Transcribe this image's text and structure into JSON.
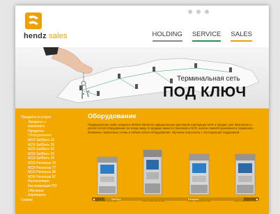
{
  "header": {
    "logo_brand": "hendz",
    "logo_sub": "sales",
    "nav": [
      {
        "label": "HOLDING"
      },
      {
        "label": "SERVICE"
      },
      {
        "label": "SALES"
      }
    ]
  },
  "hero": {
    "title": "Терминальная сеть",
    "subtitle": "ПОД КЛЮЧ"
  },
  "sidebar": {
    "items": [
      {
        "label": "Продукты и услуги"
      },
      {
        "label": "Экспресс-ч"
      },
      {
        "label": "комплексн"
      },
      {
        "label": "Продукты"
      },
      {
        "label": "Оборудование"
      },
      {
        "label": "NCR SelfServ 22"
      },
      {
        "label": "NCR SelfServ 25"
      },
      {
        "label": "NCR SelfServ 26"
      },
      {
        "label": "NCR SelfServ 32"
      },
      {
        "label": "NCR SelfServ 34"
      },
      {
        "label": "NCR Personas 75"
      },
      {
        "label": "NCR Personas 77"
      },
      {
        "label": "NCR Personas 86"
      },
      {
        "label": "NCR Personas 87"
      },
      {
        "label": "Инсталляция"
      },
      {
        "label": "Кастомизация ПО"
      },
      {
        "label": "Обучение"
      },
      {
        "label": "Аэропорты"
      },
      {
        "label": "Сервис"
      }
    ]
  },
  "main": {
    "title": "Оборудование",
    "text": "Подразделение Sales холдинга HENDZ является официальным партнером корпорации NCR и продает для банковских и ритейл-сетей оборудование по всему миру. В продаже имеются банкоматы NCR, киоски самообслуживания и терминалы. Возможны лизинговые схемы и гибкая оплата оборудования, обучение персонала с последующей поддержкой.",
    "products": [
      {
        "label": "NCR SelfServ 25"
      },
      {
        "label": "NCR SelfServ 26"
      },
      {
        "label": "NCR SelfServ 32"
      },
      {
        "label": "NCR SelfServ 34"
      }
    ],
    "scroll_left": "SelfServ",
    "scroll_mid": "Personas"
  },
  "colors": {
    "accent": "#f3a800",
    "nav_service": "#2e8b57"
  }
}
